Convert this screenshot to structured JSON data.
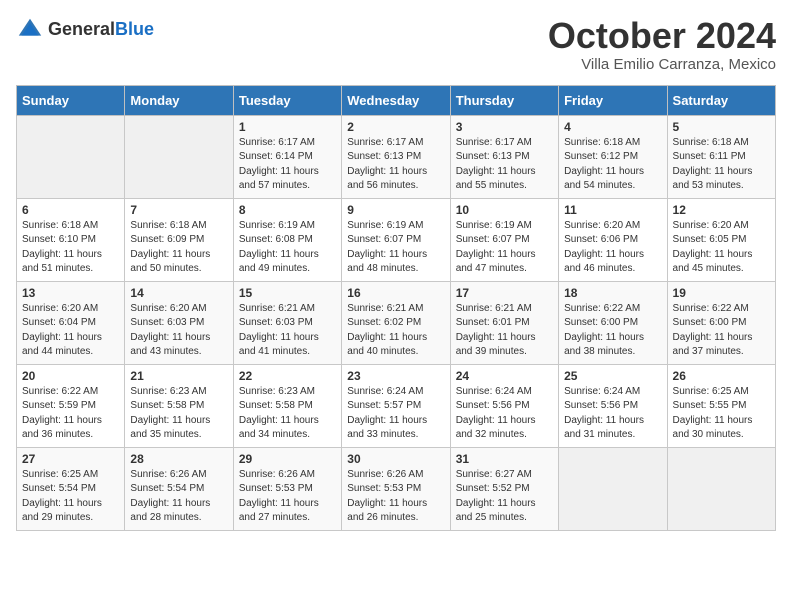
{
  "logo": {
    "text_general": "General",
    "text_blue": "Blue"
  },
  "title": "October 2024",
  "subtitle": "Villa Emilio Carranza, Mexico",
  "days_of_week": [
    "Sunday",
    "Monday",
    "Tuesday",
    "Wednesday",
    "Thursday",
    "Friday",
    "Saturday"
  ],
  "weeks": [
    [
      {
        "day": "",
        "sunrise": "",
        "sunset": "",
        "daylight": "",
        "empty": true
      },
      {
        "day": "",
        "sunrise": "",
        "sunset": "",
        "daylight": "",
        "empty": true
      },
      {
        "day": "1",
        "sunrise": "Sunrise: 6:17 AM",
        "sunset": "Sunset: 6:14 PM",
        "daylight": "Daylight: 11 hours and 57 minutes.",
        "empty": false
      },
      {
        "day": "2",
        "sunrise": "Sunrise: 6:17 AM",
        "sunset": "Sunset: 6:13 PM",
        "daylight": "Daylight: 11 hours and 56 minutes.",
        "empty": false
      },
      {
        "day": "3",
        "sunrise": "Sunrise: 6:17 AM",
        "sunset": "Sunset: 6:13 PM",
        "daylight": "Daylight: 11 hours and 55 minutes.",
        "empty": false
      },
      {
        "day": "4",
        "sunrise": "Sunrise: 6:18 AM",
        "sunset": "Sunset: 6:12 PM",
        "daylight": "Daylight: 11 hours and 54 minutes.",
        "empty": false
      },
      {
        "day": "5",
        "sunrise": "Sunrise: 6:18 AM",
        "sunset": "Sunset: 6:11 PM",
        "daylight": "Daylight: 11 hours and 53 minutes.",
        "empty": false
      }
    ],
    [
      {
        "day": "6",
        "sunrise": "Sunrise: 6:18 AM",
        "sunset": "Sunset: 6:10 PM",
        "daylight": "Daylight: 11 hours and 51 minutes.",
        "empty": false
      },
      {
        "day": "7",
        "sunrise": "Sunrise: 6:18 AM",
        "sunset": "Sunset: 6:09 PM",
        "daylight": "Daylight: 11 hours and 50 minutes.",
        "empty": false
      },
      {
        "day": "8",
        "sunrise": "Sunrise: 6:19 AM",
        "sunset": "Sunset: 6:08 PM",
        "daylight": "Daylight: 11 hours and 49 minutes.",
        "empty": false
      },
      {
        "day": "9",
        "sunrise": "Sunrise: 6:19 AM",
        "sunset": "Sunset: 6:07 PM",
        "daylight": "Daylight: 11 hours and 48 minutes.",
        "empty": false
      },
      {
        "day": "10",
        "sunrise": "Sunrise: 6:19 AM",
        "sunset": "Sunset: 6:07 PM",
        "daylight": "Daylight: 11 hours and 47 minutes.",
        "empty": false
      },
      {
        "day": "11",
        "sunrise": "Sunrise: 6:20 AM",
        "sunset": "Sunset: 6:06 PM",
        "daylight": "Daylight: 11 hours and 46 minutes.",
        "empty": false
      },
      {
        "day": "12",
        "sunrise": "Sunrise: 6:20 AM",
        "sunset": "Sunset: 6:05 PM",
        "daylight": "Daylight: 11 hours and 45 minutes.",
        "empty": false
      }
    ],
    [
      {
        "day": "13",
        "sunrise": "Sunrise: 6:20 AM",
        "sunset": "Sunset: 6:04 PM",
        "daylight": "Daylight: 11 hours and 44 minutes.",
        "empty": false
      },
      {
        "day": "14",
        "sunrise": "Sunrise: 6:20 AM",
        "sunset": "Sunset: 6:03 PM",
        "daylight": "Daylight: 11 hours and 43 minutes.",
        "empty": false
      },
      {
        "day": "15",
        "sunrise": "Sunrise: 6:21 AM",
        "sunset": "Sunset: 6:03 PM",
        "daylight": "Daylight: 11 hours and 41 minutes.",
        "empty": false
      },
      {
        "day": "16",
        "sunrise": "Sunrise: 6:21 AM",
        "sunset": "Sunset: 6:02 PM",
        "daylight": "Daylight: 11 hours and 40 minutes.",
        "empty": false
      },
      {
        "day": "17",
        "sunrise": "Sunrise: 6:21 AM",
        "sunset": "Sunset: 6:01 PM",
        "daylight": "Daylight: 11 hours and 39 minutes.",
        "empty": false
      },
      {
        "day": "18",
        "sunrise": "Sunrise: 6:22 AM",
        "sunset": "Sunset: 6:00 PM",
        "daylight": "Daylight: 11 hours and 38 minutes.",
        "empty": false
      },
      {
        "day": "19",
        "sunrise": "Sunrise: 6:22 AM",
        "sunset": "Sunset: 6:00 PM",
        "daylight": "Daylight: 11 hours and 37 minutes.",
        "empty": false
      }
    ],
    [
      {
        "day": "20",
        "sunrise": "Sunrise: 6:22 AM",
        "sunset": "Sunset: 5:59 PM",
        "daylight": "Daylight: 11 hours and 36 minutes.",
        "empty": false
      },
      {
        "day": "21",
        "sunrise": "Sunrise: 6:23 AM",
        "sunset": "Sunset: 5:58 PM",
        "daylight": "Daylight: 11 hours and 35 minutes.",
        "empty": false
      },
      {
        "day": "22",
        "sunrise": "Sunrise: 6:23 AM",
        "sunset": "Sunset: 5:58 PM",
        "daylight": "Daylight: 11 hours and 34 minutes.",
        "empty": false
      },
      {
        "day": "23",
        "sunrise": "Sunrise: 6:24 AM",
        "sunset": "Sunset: 5:57 PM",
        "daylight": "Daylight: 11 hours and 33 minutes.",
        "empty": false
      },
      {
        "day": "24",
        "sunrise": "Sunrise: 6:24 AM",
        "sunset": "Sunset: 5:56 PM",
        "daylight": "Daylight: 11 hours and 32 minutes.",
        "empty": false
      },
      {
        "day": "25",
        "sunrise": "Sunrise: 6:24 AM",
        "sunset": "Sunset: 5:56 PM",
        "daylight": "Daylight: 11 hours and 31 minutes.",
        "empty": false
      },
      {
        "day": "26",
        "sunrise": "Sunrise: 6:25 AM",
        "sunset": "Sunset: 5:55 PM",
        "daylight": "Daylight: 11 hours and 30 minutes.",
        "empty": false
      }
    ],
    [
      {
        "day": "27",
        "sunrise": "Sunrise: 6:25 AM",
        "sunset": "Sunset: 5:54 PM",
        "daylight": "Daylight: 11 hours and 29 minutes.",
        "empty": false
      },
      {
        "day": "28",
        "sunrise": "Sunrise: 6:26 AM",
        "sunset": "Sunset: 5:54 PM",
        "daylight": "Daylight: 11 hours and 28 minutes.",
        "empty": false
      },
      {
        "day": "29",
        "sunrise": "Sunrise: 6:26 AM",
        "sunset": "Sunset: 5:53 PM",
        "daylight": "Daylight: 11 hours and 27 minutes.",
        "empty": false
      },
      {
        "day": "30",
        "sunrise": "Sunrise: 6:26 AM",
        "sunset": "Sunset: 5:53 PM",
        "daylight": "Daylight: 11 hours and 26 minutes.",
        "empty": false
      },
      {
        "day": "31",
        "sunrise": "Sunrise: 6:27 AM",
        "sunset": "Sunset: 5:52 PM",
        "daylight": "Daylight: 11 hours and 25 minutes.",
        "empty": false
      },
      {
        "day": "",
        "sunrise": "",
        "sunset": "",
        "daylight": "",
        "empty": true
      },
      {
        "day": "",
        "sunrise": "",
        "sunset": "",
        "daylight": "",
        "empty": true
      }
    ]
  ]
}
